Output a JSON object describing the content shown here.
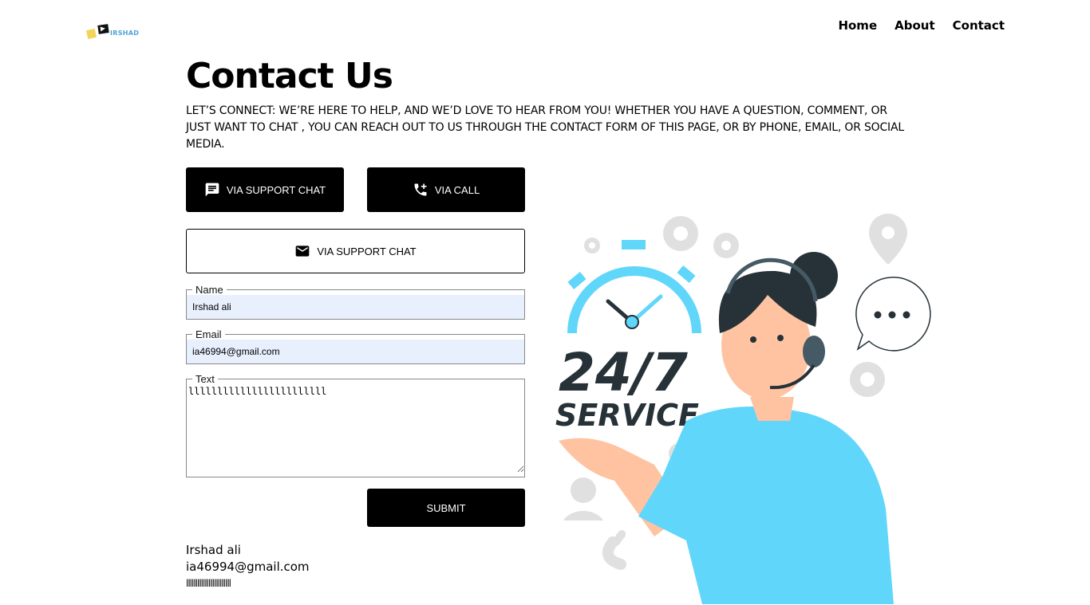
{
  "logo": {
    "text": "IRSHAD"
  },
  "nav": {
    "home": "Home",
    "about": "About",
    "contact": "Contact"
  },
  "page": {
    "title": "Contact Us",
    "intro": "Let’s Connect: We’re here to help, and we’d love to hear from you! Whether you have a question, comment, or just want to chat , you can reach out to us through the contact form of this page, or by phone, email, or social media."
  },
  "buttons": {
    "support_chat": "VIA SUPPORT CHAT",
    "call": "VIA CALL",
    "email": "VIA SUPPORT CHAT",
    "submit": "SUBMIT"
  },
  "form": {
    "name_label": "Name",
    "name_value": "Irshad ali",
    "email_label": "Email",
    "email_value": "ia46994@gmail.com",
    "text_label": "Text",
    "text_value": "llllllllllllllllllllllll"
  },
  "output": {
    "name": "Irshad ali",
    "email": "ia46994@gmail.com",
    "text": "llllllllllllllllllllllll"
  },
  "illustration": {
    "headline": "24/7",
    "subline": "SERVICE"
  },
  "colors": {
    "accent": "#61d6fb",
    "dark": "#263238",
    "button": "#000000"
  }
}
